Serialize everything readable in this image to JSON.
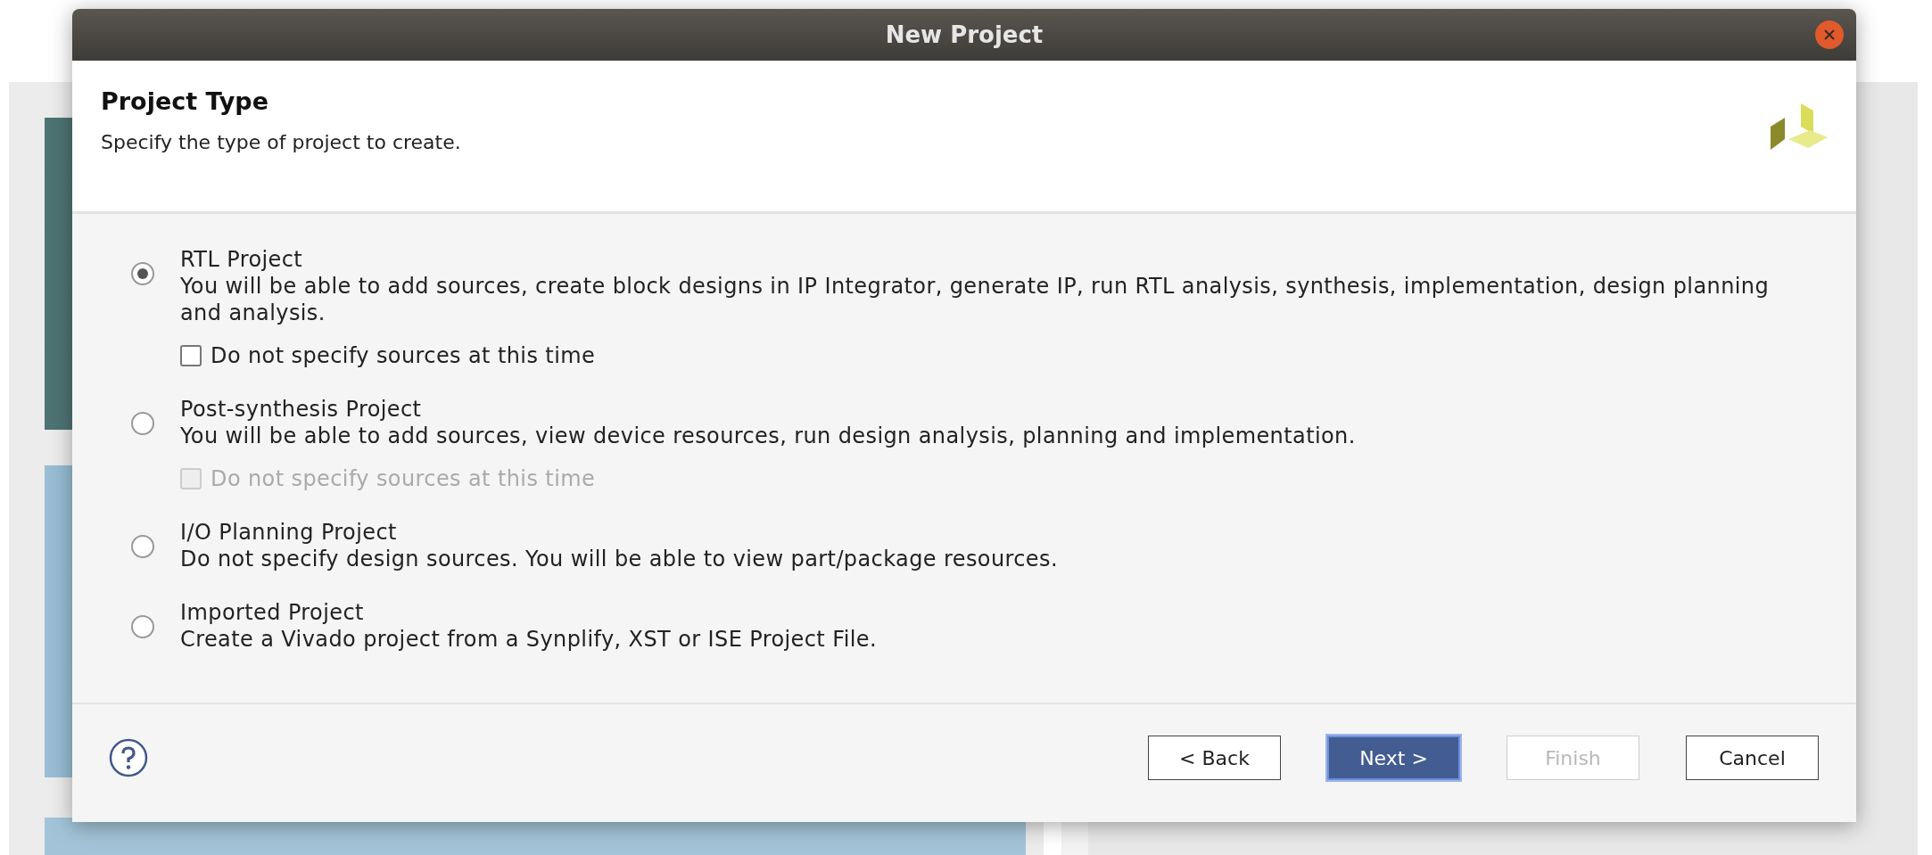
{
  "window": {
    "title": "New Project"
  },
  "header": {
    "title": "Project Type",
    "subtitle": "Specify the type of project to create."
  },
  "options": [
    {
      "label": "RTL Project",
      "selected": true,
      "description": "You will be able to add sources, create block designs in IP Integrator, generate IP, run RTL analysis, synthesis, implementation, design planning and analysis.",
      "checkbox": {
        "label": "Do not specify sources at this time",
        "checked": false,
        "disabled": false
      }
    },
    {
      "label": "Post-synthesis Project",
      "selected": false,
      "description": "You will be able to add sources, view device resources, run design analysis, planning and implementation.",
      "checkbox": {
        "label": "Do not specify sources at this time",
        "checked": false,
        "disabled": true
      }
    },
    {
      "label": "I/O Planning Project",
      "selected": false,
      "description": "Do not specify design sources. You will be able to view part/package resources."
    },
    {
      "label": "Imported Project",
      "selected": false,
      "description": "Create a Vivado project from a Synplify, XST or ISE Project File."
    }
  ],
  "buttons": [
    {
      "label": "< Back",
      "kind": "normal",
      "disabled": false
    },
    {
      "label": "Next >",
      "kind": "default",
      "disabled": false
    },
    {
      "label": "Finish",
      "kind": "normal",
      "disabled": true
    },
    {
      "label": "Cancel",
      "kind": "normal",
      "disabled": false
    }
  ]
}
